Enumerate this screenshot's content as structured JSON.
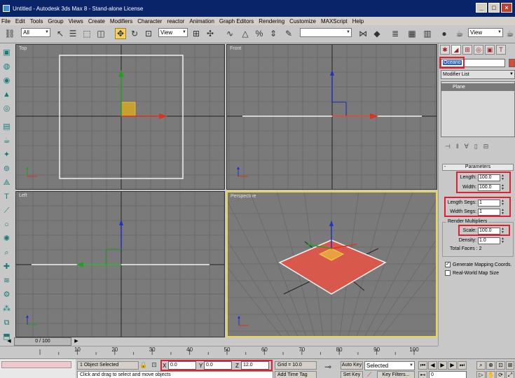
{
  "window": {
    "title": "Untitled - Autodesk 3ds Max 8 - Stand-alone License",
    "buttons": [
      "_",
      "□",
      "×"
    ]
  },
  "menu": [
    "File",
    "Edit",
    "Tools",
    "Group",
    "Views",
    "Create",
    "Modifiers",
    "Character",
    "reactor",
    "Animation",
    "Graph Editors",
    "Rendering",
    "Customize",
    "MAXScript",
    "Help"
  ],
  "toolbar": {
    "selection_filter": "All",
    "ref_coord": "View",
    "named_selection": "",
    "render_view": "View"
  },
  "viewports": {
    "top": "Top",
    "front": "Front",
    "left": "Left",
    "perspective": "Perspective"
  },
  "command_panel": {
    "object_name": "Oceano",
    "object_color": "#e0483a",
    "modifier_list": "Modifier List",
    "stack_item": "Plane",
    "rollout_title": "Parameters",
    "params": {
      "length_label": "Length:",
      "length": "100.0",
      "width_label": "Width:",
      "width": "100.0",
      "length_segs_label": "Length Segs:",
      "length_segs": "1",
      "width_segs_label": "Width Segs:",
      "width_segs": "1",
      "render_multipliers": "Render Multipliers",
      "scale_label": "Scale:",
      "scale": "100.0",
      "density_label": "Density:",
      "density": "1.0",
      "total_faces": "Total Faces : 2",
      "gen_mapping": "Generate Mapping Coords.",
      "realworld": "Real-World Map Size"
    }
  },
  "timeline": {
    "slider": "0 / 100",
    "ticks": [
      "10",
      "20",
      "30",
      "40",
      "50",
      "60",
      "70",
      "80",
      "90",
      "100"
    ]
  },
  "status": {
    "selection": "1 Object Selected",
    "prompt": "Click and drag to select and move objects",
    "x_label": "X",
    "x": "0.0",
    "y_label": "Y",
    "y": "0.0",
    "z_label": "Z",
    "z": "12.0",
    "grid": "Grid = 10.0",
    "add_time_tag": "Add Time Tag",
    "auto_key": "Auto Key",
    "set_key": "Set Key",
    "key_mode": "Selected",
    "key_filters": "Key Filters...",
    "frame": "0"
  }
}
